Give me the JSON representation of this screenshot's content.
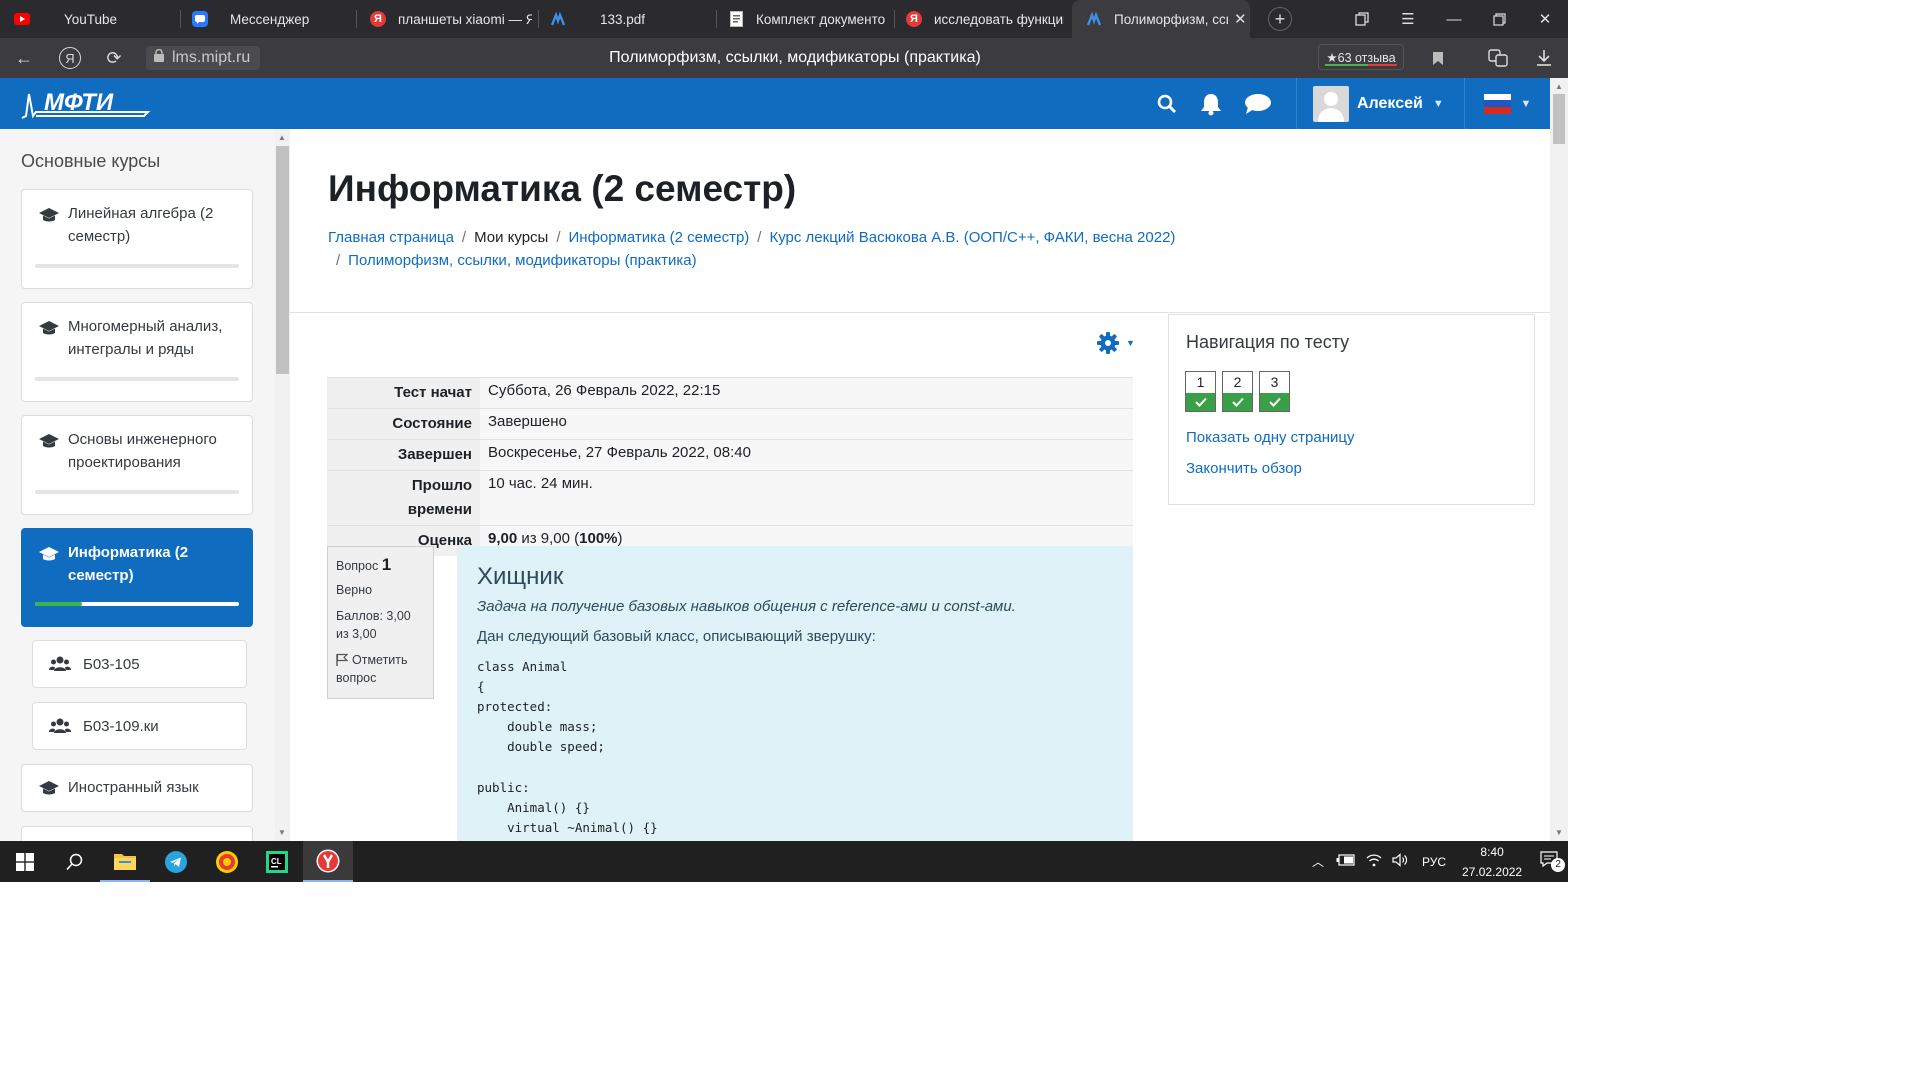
{
  "browser": {
    "tabs": [
      {
        "label": "YouTube",
        "icon": "youtube-icon",
        "color": "#ff0000"
      },
      {
        "label": "Мессенджер",
        "icon": "messenger-icon",
        "color": "#2979ff"
      },
      {
        "label": "планшеты xiaomi — Я",
        "icon": "yandex-icon",
        "color": "#e53935"
      },
      {
        "label": "133.pdf",
        "icon": "moodle-icon",
        "color": "#3d8fe0"
      },
      {
        "label": "Комплект документо",
        "icon": "document-icon",
        "color": "#e0e0e0"
      },
      {
        "label": "исследовать функцию",
        "icon": "yandex-icon",
        "color": "#e53935"
      },
      {
        "label": "Полиморфизм, ссы",
        "icon": "moodle-icon",
        "color": "#3d8fe0",
        "active": true
      }
    ],
    "url": "lms.mipt.ru",
    "page_title": "Полиморфизм, ссылки, модификаторы (практика)",
    "reviews": "★63 отзыва"
  },
  "navbar": {
    "logo_text": "МФТИ",
    "user_name": "Алексей",
    "accent": "#0f6cbf"
  },
  "sidebar": {
    "title": "Основные курсы",
    "courses": [
      {
        "label": "Линейная алгебра (2 семестр)"
      },
      {
        "label": "Многомерный анализ, интегралы и ряды"
      },
      {
        "label": "Основы инженерного проектирования"
      },
      {
        "label": "Информатика (2 семестр)",
        "active": true,
        "progress": 0.23
      },
      {
        "label": "Б03-105",
        "type": "group"
      },
      {
        "label": "Б03-109.ки",
        "type": "group"
      },
      {
        "label": "Иностранный язык"
      }
    ]
  },
  "main": {
    "title": "Информатика (2 семестр)",
    "breadcrumbs": {
      "home": "Главная страница",
      "my_courses": "Мои курсы",
      "course": "Информатика (2 семестр)",
      "lectures": "Курс лекций Васюкова А.В. (ООП/С++, ФАКИ, весна 2022)",
      "activity": "Полиморфизм, ссылки, модификаторы (практика)"
    },
    "summary": {
      "started_label": "Тест начат",
      "started_value": "Суббота, 26 Февраль 2022, 22:15",
      "state_label": "Состояние",
      "state_value": "Завершено",
      "finished_label": "Завершен",
      "finished_value": "Воскресенье, 27 Февраль 2022, 08:40",
      "elapsed_label": "Прошло времени",
      "elapsed_value": "10 час. 24 мин.",
      "grade_label": "Оценка",
      "grade_score": "9,00",
      "grade_of": " из 9,00 (",
      "grade_percent": "100%",
      "grade_close": ")"
    },
    "question": {
      "label": "Вопрос",
      "number": "1",
      "status": "Верно",
      "marks": "Баллов: 3,00 из 3,00",
      "flag_label": "Отметить вопрос",
      "name": "Хищник",
      "intro": "Задача на получение базовых навыков общения с reference-ами и const-ами.",
      "description": "Дан следующий базовый класс, описывающий зверушку:",
      "code": "class Animal\n{\nprotected:\n    double mass;\n    double speed;\n\npublic:\n    Animal() {}\n    virtual ~Animal() {}"
    }
  },
  "quiz_nav": {
    "title": "Навигация по тесту",
    "questions": [
      "1",
      "2",
      "3"
    ],
    "show_one_page": "Показать одну страницу",
    "finish_review": "Закончить обзор"
  },
  "taskbar": {
    "language": "РУС",
    "time": "8:40",
    "date": "27.02.2022",
    "notifications": "2"
  }
}
